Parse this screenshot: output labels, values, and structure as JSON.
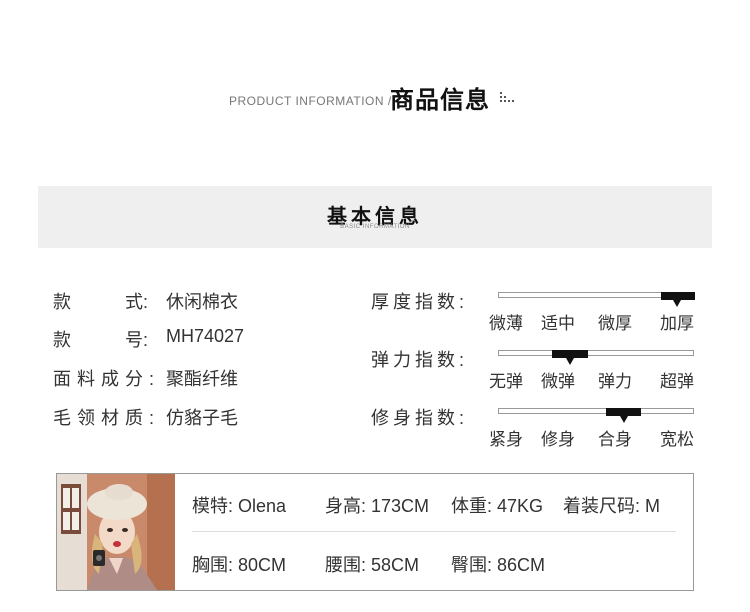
{
  "header": {
    "en": "PRODUCT INFORMATION /",
    "zh": "商品信息"
  },
  "basic": {
    "title": "基本信息",
    "subtitle": "BASIC INFORMATION"
  },
  "info": [
    {
      "label_a": "款",
      "label_b": "式:",
      "value": "休闲棉衣"
    },
    {
      "label_a": "款",
      "label_b": "号:",
      "value": "MH74027"
    },
    {
      "label": "面料成分:",
      "value": "聚酯纤维"
    },
    {
      "label": "毛领材质:",
      "value": "仿貉子毛"
    }
  ],
  "indices": [
    {
      "label": "厚度指数:",
      "scale": [
        "微薄",
        "适中",
        "微厚",
        "加厚"
      ],
      "selected": "加厚"
    },
    {
      "label": "弹力指数:",
      "scale": [
        "无弹",
        "微弹",
        "弹力",
        "超弹"
      ],
      "selected": "微弹"
    },
    {
      "label": "修身指数:",
      "scale": [
        "紧身",
        "修身",
        "合身",
        "宽松"
      ],
      "selected": "合身"
    }
  ],
  "model": {
    "name": "模特: Olena",
    "height": "身高: 173CM",
    "weight": "体重: 47KG",
    "size": "着装尺码: M",
    "bust": "胸围: 80CM",
    "waist": "腰围: 58CM",
    "hip": "臀围: 86CM"
  },
  "colors": {
    "bar_fill": "#111111",
    "section_bg": "#efefef",
    "photo_bg": "#c98a6c"
  }
}
